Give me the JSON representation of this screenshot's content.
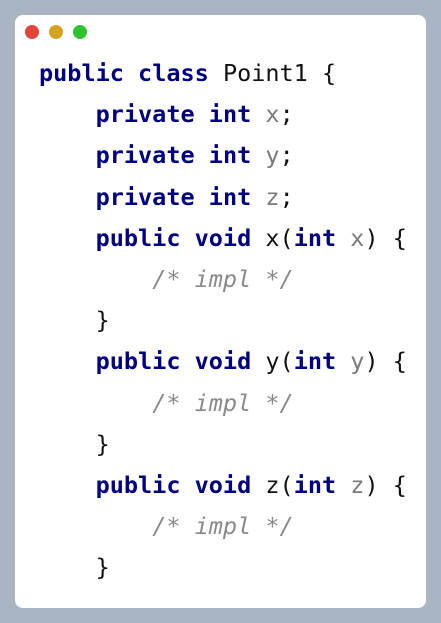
{
  "window": {
    "buttons": [
      {
        "name": "close",
        "color": "#e0443e"
      },
      {
        "name": "minimize",
        "color": "#d4a31f"
      },
      {
        "name": "maximize",
        "color": "#2ec22e"
      }
    ]
  },
  "code": {
    "lines": [
      {
        "indent": "",
        "tokens": [
          {
            "t": "public",
            "c": "kw"
          },
          {
            "t": " "
          },
          {
            "t": "class",
            "c": "kw"
          },
          {
            "t": " Point1 {"
          }
        ]
      },
      {
        "indent": "    ",
        "tokens": [
          {
            "t": "private",
            "c": "kw"
          },
          {
            "t": " "
          },
          {
            "t": "int",
            "c": "kw"
          },
          {
            "t": " "
          },
          {
            "t": "x",
            "c": "var"
          },
          {
            "t": ";"
          }
        ]
      },
      {
        "indent": "    ",
        "tokens": [
          {
            "t": "private",
            "c": "kw"
          },
          {
            "t": " "
          },
          {
            "t": "int",
            "c": "kw"
          },
          {
            "t": " "
          },
          {
            "t": "y",
            "c": "var"
          },
          {
            "t": ";"
          }
        ]
      },
      {
        "indent": "    ",
        "tokens": [
          {
            "t": "private",
            "c": "kw"
          },
          {
            "t": " "
          },
          {
            "t": "int",
            "c": "kw"
          },
          {
            "t": " "
          },
          {
            "t": "z",
            "c": "var"
          },
          {
            "t": ";"
          }
        ]
      },
      {
        "indent": "    ",
        "tokens": [
          {
            "t": "public",
            "c": "kw"
          },
          {
            "t": " "
          },
          {
            "t": "void",
            "c": "kw"
          },
          {
            "t": " x("
          },
          {
            "t": "int",
            "c": "kw"
          },
          {
            "t": " "
          },
          {
            "t": "x",
            "c": "var"
          },
          {
            "t": ") {"
          }
        ]
      },
      {
        "indent": "        ",
        "tokens": [
          {
            "t": "/* impl */",
            "c": "cm"
          }
        ]
      },
      {
        "indent": "    ",
        "tokens": [
          {
            "t": "}"
          }
        ]
      },
      {
        "indent": "    ",
        "tokens": [
          {
            "t": "public",
            "c": "kw"
          },
          {
            "t": " "
          },
          {
            "t": "void",
            "c": "kw"
          },
          {
            "t": " y("
          },
          {
            "t": "int",
            "c": "kw"
          },
          {
            "t": " "
          },
          {
            "t": "y",
            "c": "var"
          },
          {
            "t": ") {"
          }
        ]
      },
      {
        "indent": "        ",
        "tokens": [
          {
            "t": "/* impl */",
            "c": "cm"
          }
        ]
      },
      {
        "indent": "    ",
        "tokens": [
          {
            "t": "}"
          }
        ]
      },
      {
        "indent": "    ",
        "tokens": [
          {
            "t": "public",
            "c": "kw"
          },
          {
            "t": " "
          },
          {
            "t": "void",
            "c": "kw"
          },
          {
            "t": " z("
          },
          {
            "t": "int",
            "c": "kw"
          },
          {
            "t": " "
          },
          {
            "t": "z",
            "c": "var"
          },
          {
            "t": ") {"
          }
        ]
      },
      {
        "indent": "        ",
        "tokens": [
          {
            "t": "/* impl */",
            "c": "cm"
          }
        ]
      },
      {
        "indent": "    ",
        "tokens": [
          {
            "t": "}"
          }
        ]
      }
    ]
  }
}
